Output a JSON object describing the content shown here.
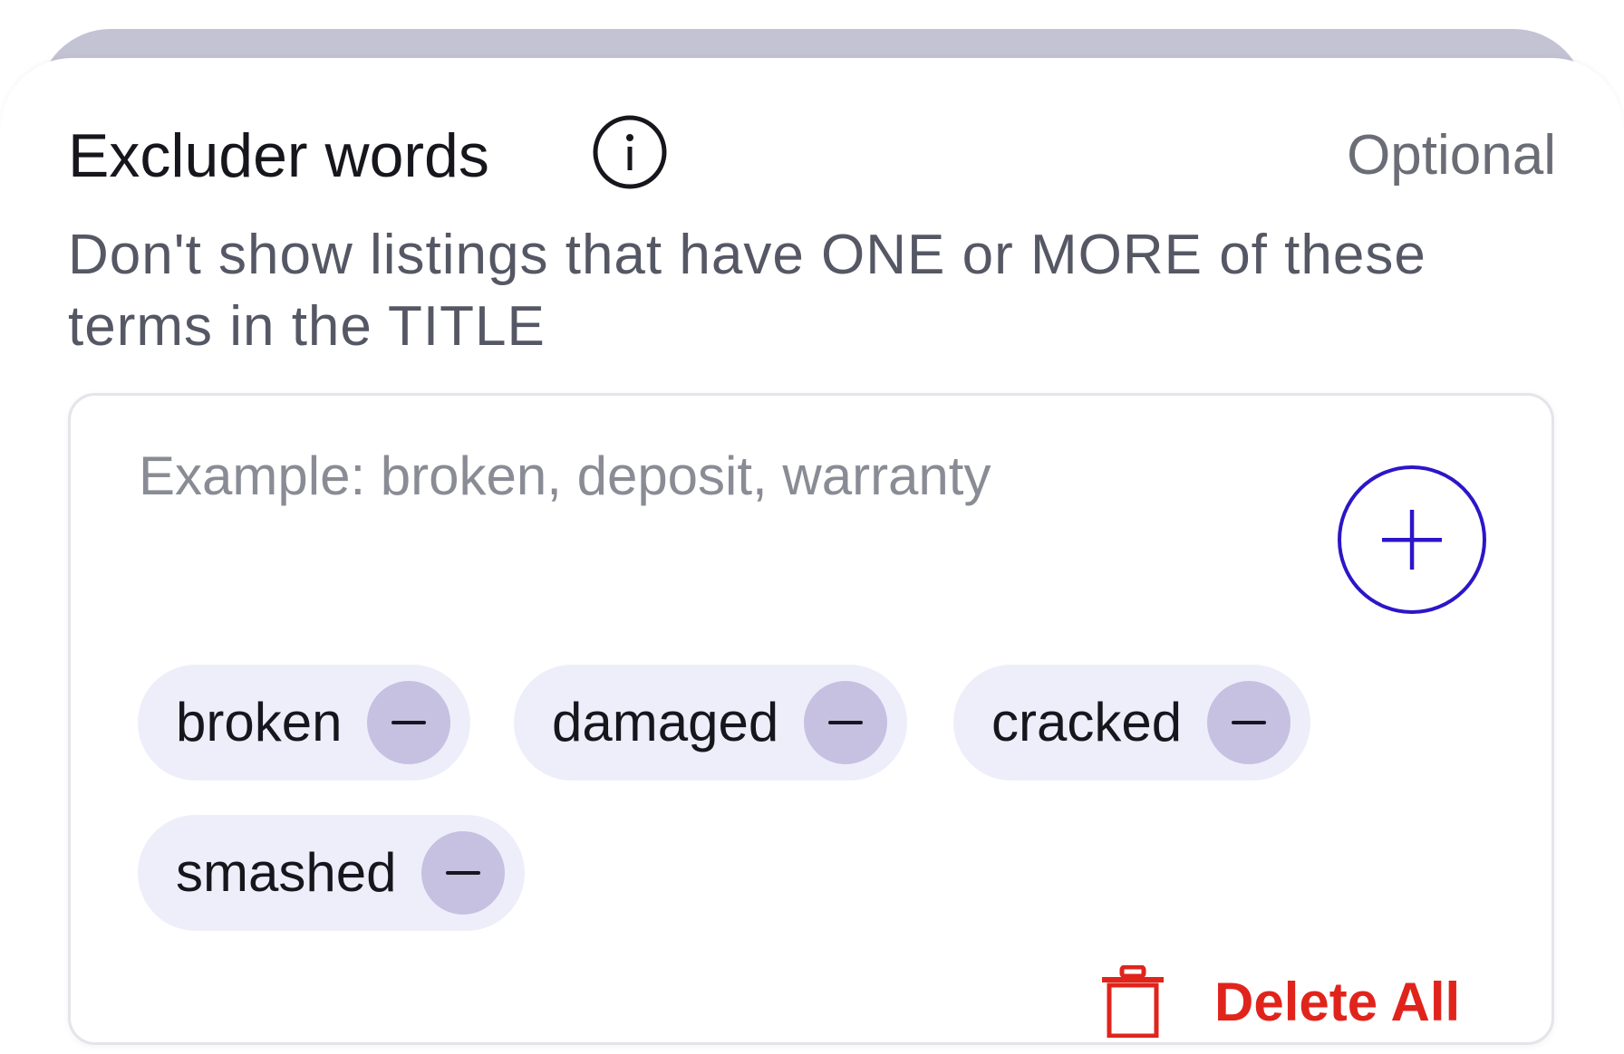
{
  "section": {
    "title": "Excluder words",
    "optional_label": "Optional",
    "description": "Don't show listings that have ONE or MORE of these terms in the TITLE"
  },
  "input": {
    "placeholder": "Example: broken, deposit, warranty"
  },
  "icons": {
    "info": "info-icon",
    "add": "plus-circle-icon",
    "remove": "minus-icon",
    "delete": "trash-icon"
  },
  "chips": [
    {
      "label": "broken"
    },
    {
      "label": "damaged"
    },
    {
      "label": "cracked"
    },
    {
      "label": "smashed"
    }
  ],
  "actions": {
    "delete_all_label": "Delete All"
  },
  "colors": {
    "accent": "#2b16c8",
    "chip_background": "#eeeefb",
    "chip_remove_background": "#c6c0e1",
    "danger": "#e0241c",
    "top_strip": "#c4c3d4"
  }
}
